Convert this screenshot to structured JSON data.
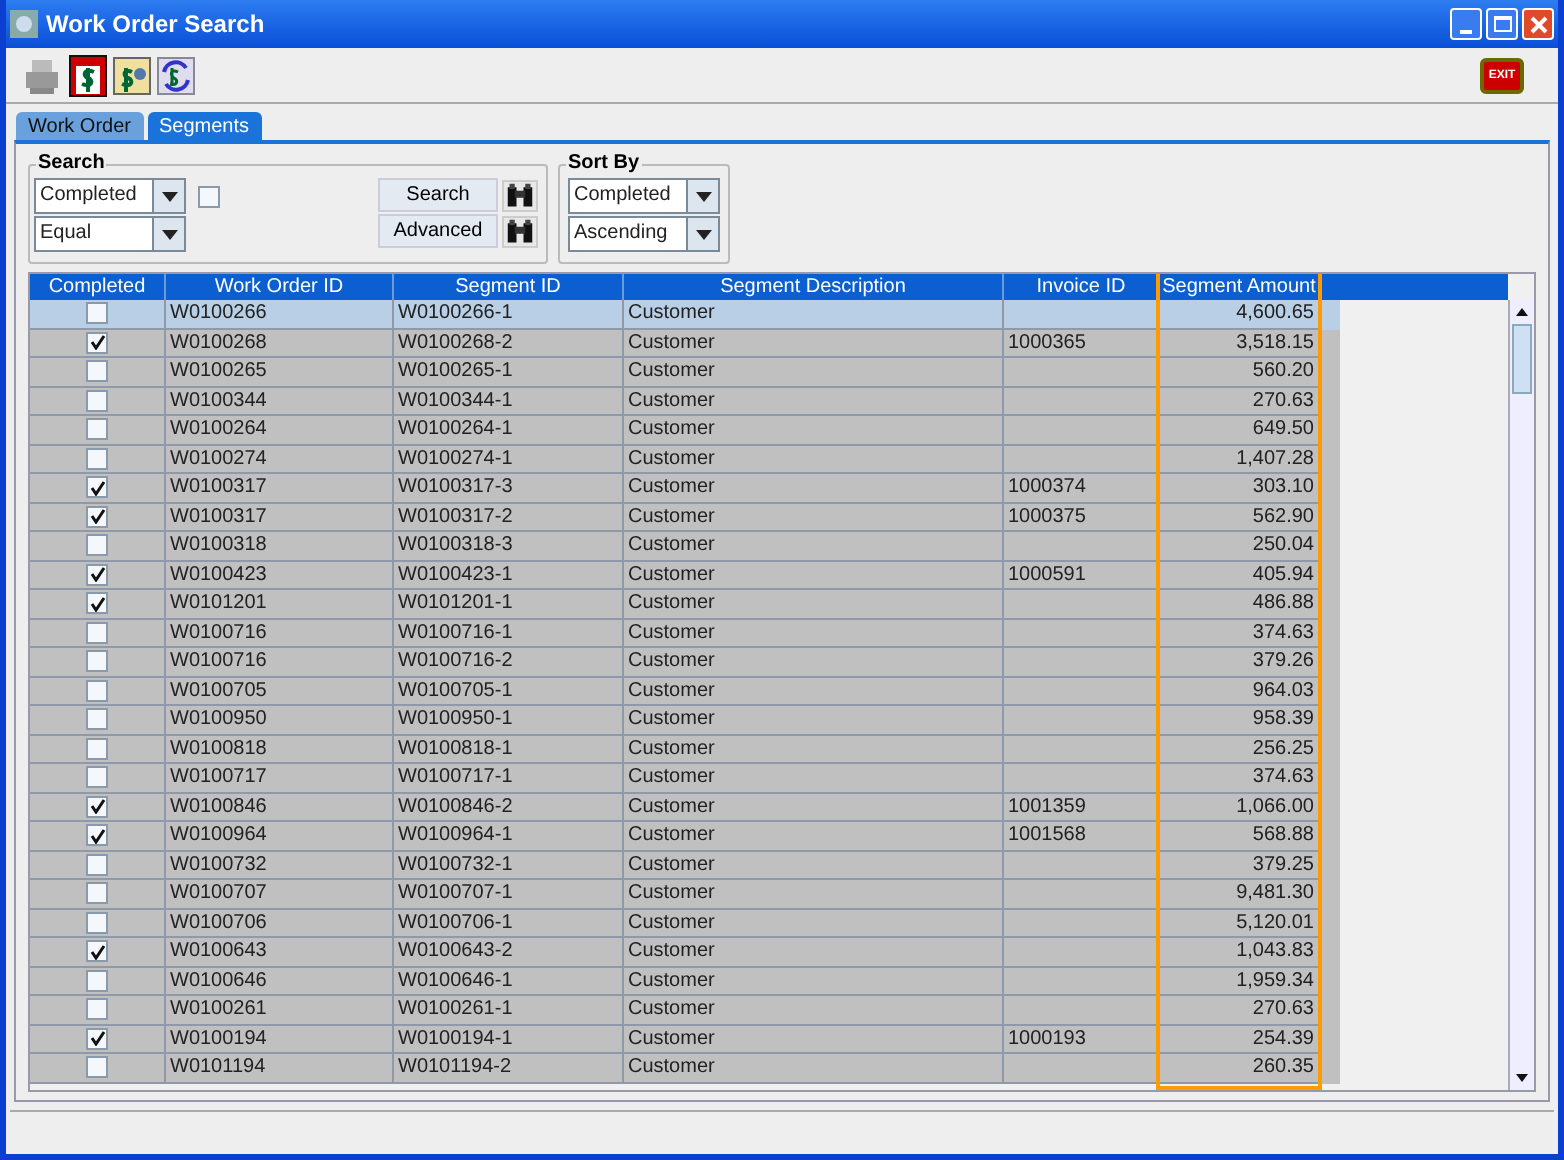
{
  "window": {
    "title": "Work Order Search"
  },
  "toolbar": {
    "exit_label": "EXIT"
  },
  "tabs": [
    {
      "label": "Work Order",
      "selected": false
    },
    {
      "label": "Segments",
      "selected": true
    }
  ],
  "search": {
    "title": "Search",
    "field": "Completed",
    "operator": "Equal",
    "value_checked": false,
    "search_button": "Search",
    "advanced_button": "Advanced"
  },
  "sort": {
    "title": "Sort By",
    "field": "Completed",
    "order": "Ascending"
  },
  "table": {
    "columns": [
      {
        "label": "Completed",
        "highlighted": false
      },
      {
        "label": "Work Order ID",
        "highlighted": false
      },
      {
        "label": "Segment ID",
        "highlighted": false
      },
      {
        "label": "Segment Description",
        "highlighted": false
      },
      {
        "label": "Invoice ID",
        "highlighted": false
      },
      {
        "label": "Segment Amount",
        "highlighted": true
      }
    ],
    "rows": [
      {
        "completed": false,
        "selected": true,
        "work_order": "W0100266",
        "segment": "W0100266-1",
        "description": "Customer",
        "invoice": "",
        "amount": "4,600.65"
      },
      {
        "completed": true,
        "selected": false,
        "work_order": "W0100268",
        "segment": "W0100268-2",
        "description": "Customer",
        "invoice": "1000365",
        "amount": "3,518.15"
      },
      {
        "completed": false,
        "selected": false,
        "work_order": "W0100265",
        "segment": "W0100265-1",
        "description": "Customer",
        "invoice": "",
        "amount": "560.20"
      },
      {
        "completed": false,
        "selected": false,
        "work_order": "W0100344",
        "segment": "W0100344-1",
        "description": "Customer",
        "invoice": "",
        "amount": "270.63"
      },
      {
        "completed": false,
        "selected": false,
        "work_order": "W0100264",
        "segment": "W0100264-1",
        "description": "Customer",
        "invoice": "",
        "amount": "649.50"
      },
      {
        "completed": false,
        "selected": false,
        "work_order": "W0100274",
        "segment": "W0100274-1",
        "description": "Customer",
        "invoice": "",
        "amount": "1,407.28"
      },
      {
        "completed": true,
        "selected": false,
        "work_order": "W0100317",
        "segment": "W0100317-3",
        "description": "Customer",
        "invoice": "1000374",
        "amount": "303.10"
      },
      {
        "completed": true,
        "selected": false,
        "work_order": "W0100317",
        "segment": "W0100317-2",
        "description": "Customer",
        "invoice": "1000375",
        "amount": "562.90"
      },
      {
        "completed": false,
        "selected": false,
        "work_order": "W0100318",
        "segment": "W0100318-3",
        "description": "Customer",
        "invoice": "",
        "amount": "250.04"
      },
      {
        "completed": true,
        "selected": false,
        "work_order": "W0100423",
        "segment": "W0100423-1",
        "description": "Customer",
        "invoice": "1000591",
        "amount": "405.94"
      },
      {
        "completed": true,
        "selected": false,
        "work_order": "W0101201",
        "segment": "W0101201-1",
        "description": "Customer",
        "invoice": "",
        "amount": "486.88"
      },
      {
        "completed": false,
        "selected": false,
        "work_order": "W0100716",
        "segment": "W0100716-1",
        "description": "Customer",
        "invoice": "",
        "amount": "374.63"
      },
      {
        "completed": false,
        "selected": false,
        "work_order": "W0100716",
        "segment": "W0100716-2",
        "description": "Customer",
        "invoice": "",
        "amount": "379.26"
      },
      {
        "completed": false,
        "selected": false,
        "work_order": "W0100705",
        "segment": "W0100705-1",
        "description": "Customer",
        "invoice": "",
        "amount": "964.03"
      },
      {
        "completed": false,
        "selected": false,
        "work_order": "W0100950",
        "segment": "W0100950-1",
        "description": "Customer",
        "invoice": "",
        "amount": "958.39"
      },
      {
        "completed": false,
        "selected": false,
        "work_order": "W0100818",
        "segment": "W0100818-1",
        "description": "Customer",
        "invoice": "",
        "amount": "256.25"
      },
      {
        "completed": false,
        "selected": false,
        "work_order": "W0100717",
        "segment": "W0100717-1",
        "description": "Customer",
        "invoice": "",
        "amount": "374.63"
      },
      {
        "completed": true,
        "selected": false,
        "work_order": "W0100846",
        "segment": "W0100846-2",
        "description": "Customer",
        "invoice": "1001359",
        "amount": "1,066.00"
      },
      {
        "completed": true,
        "selected": false,
        "work_order": "W0100964",
        "segment": "W0100964-1",
        "description": "Customer",
        "invoice": "1001568",
        "amount": "568.88"
      },
      {
        "completed": false,
        "selected": false,
        "work_order": "W0100732",
        "segment": "W0100732-1",
        "description": "Customer",
        "invoice": "",
        "amount": "379.25"
      },
      {
        "completed": false,
        "selected": false,
        "work_order": "W0100707",
        "segment": "W0100707-1",
        "description": "Customer",
        "invoice": "",
        "amount": "9,481.30"
      },
      {
        "completed": false,
        "selected": false,
        "work_order": "W0100706",
        "segment": "W0100706-1",
        "description": "Customer",
        "invoice": "",
        "amount": "5,120.01"
      },
      {
        "completed": true,
        "selected": false,
        "work_order": "W0100643",
        "segment": "W0100643-2",
        "description": "Customer",
        "invoice": "",
        "amount": "1,043.83"
      },
      {
        "completed": false,
        "selected": false,
        "work_order": "W0100646",
        "segment": "W0100646-1",
        "description": "Customer",
        "invoice": "",
        "amount": "1,959.34"
      },
      {
        "completed": false,
        "selected": false,
        "work_order": "W0100261",
        "segment": "W0100261-1",
        "description": "Customer",
        "invoice": "",
        "amount": "270.63"
      },
      {
        "completed": true,
        "selected": false,
        "work_order": "W0100194",
        "segment": "W0100194-1",
        "description": "Customer",
        "invoice": "1000193",
        "amount": "254.39"
      },
      {
        "completed": false,
        "selected": false,
        "work_order": "W0101194",
        "segment": "W0101194-2",
        "description": "Customer",
        "invoice": "",
        "amount": "260.35"
      }
    ]
  }
}
